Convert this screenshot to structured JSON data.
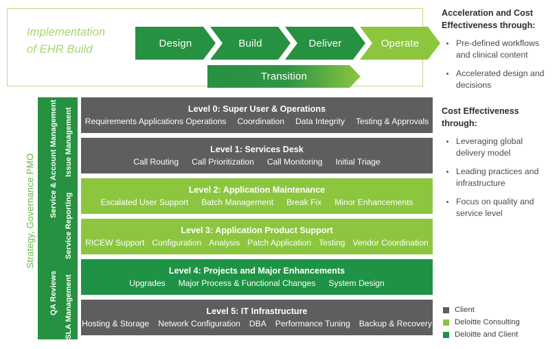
{
  "header": {
    "title": "Implementation\nof EHR Build",
    "title_line1": "Implementation",
    "title_line2": "of EHR Build",
    "phases": [
      {
        "label": "Design",
        "color": "#269140"
      },
      {
        "label": "Build",
        "color": "#269140"
      },
      {
        "label": "Deliver",
        "color": "#269140"
      },
      {
        "label": "Operate",
        "color": "#8cc63f"
      }
    ],
    "transition": {
      "label": "Transition",
      "color_start": "#269140",
      "color_end": "#8cc63f"
    }
  },
  "right_column": {
    "acceleration_heading": "Acceleration and Cost Effectiveness through:",
    "acceleration_items": [
      "Pre-defined workflows and clinical content",
      "Accelerated design and decisions"
    ],
    "cost_heading": "Cost Effectiveness through:",
    "cost_items": [
      "Leveraging global delivery model",
      "Leading practices and infrastructure",
      "Focus on quality and service level"
    ]
  },
  "legend": {
    "items": [
      {
        "label": "Client",
        "color": "#5e5e5e"
      },
      {
        "label": "Deloitte Consulting",
        "color": "#8cc63f"
      },
      {
        "label": "Deloitte and Client",
        "color": "#1f9345"
      }
    ]
  },
  "sidebar": {
    "outer_label": "Strategy, Governance PMO",
    "outer_color": "#6ab84a",
    "panel_color": "#269140",
    "vertical_labels": [
      "Service & Account Management",
      "Issue Management",
      "Service Reporting",
      "QA Reviews",
      "SLA Management"
    ]
  },
  "levels": [
    {
      "title": "Level 0: Super User & Operations",
      "items": [
        "Requirements Applications Operations",
        "Coordination",
        "Data Integrity",
        "Testing & Approvals"
      ],
      "color": "#5e5e5e",
      "owner": "Client"
    },
    {
      "title": "Level 1: Services Desk",
      "items": [
        "Call Routing",
        "Call Prioritization",
        "Call Monitoring",
        "Initial Triage"
      ],
      "color": "#5e5e5e",
      "owner": "Client"
    },
    {
      "title": "Level 2: Application Maintenance",
      "items": [
        "Escalated User Support",
        "Batch Management",
        "Break Fix",
        "Minor Enhancements"
      ],
      "color": "#8cc63f",
      "owner": "Deloitte Consulting"
    },
    {
      "title": "Level 3: Application Product Support",
      "items": [
        "RICEW Support",
        "Configuration",
        "Analysis",
        "Patch Application",
        "Testing",
        "Vendor Coordination"
      ],
      "color": "#8cc63f",
      "owner": "Deloitte Consulting"
    },
    {
      "title": "Level 4: Projects and Major Enhancements",
      "items": [
        "Upgrades",
        "Major Process & Functional Changes",
        "System Design"
      ],
      "color": "#1f9345",
      "owner": "Deloitte and Client"
    },
    {
      "title": "Level 5: IT Infrastructure",
      "items": [
        "Hosting & Storage",
        "Network Configuration",
        "DBA",
        "Performance Tuning",
        "Backup & Recovery"
      ],
      "color": "#5e5e5e",
      "owner": "Client"
    }
  ]
}
